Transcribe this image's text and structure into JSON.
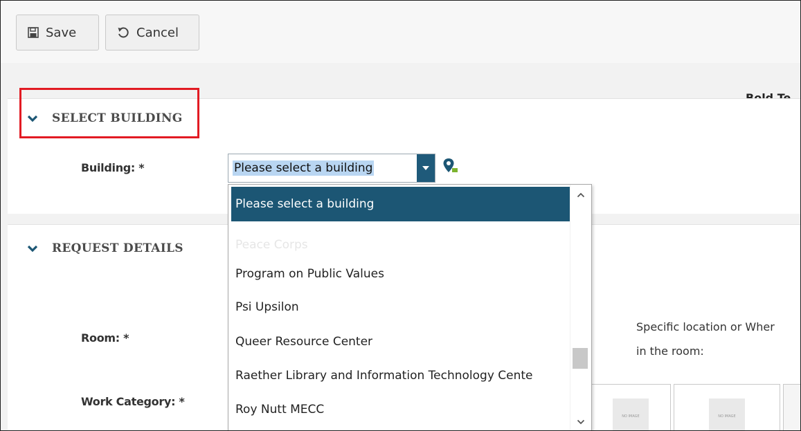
{
  "toolbar": {
    "save_label": "Save",
    "cancel_label": "Cancel"
  },
  "header": {
    "bold_text": "Bold Te"
  },
  "sections": {
    "select_building": {
      "title": "SELECT BUILDING",
      "building_label": "Building: *",
      "building_select": {
        "value": "Please select a building",
        "options": [
          "Please select a building",
          "Peace Corps",
          "Program on Public Values",
          "Psi Upsilon",
          "Queer Resource Center",
          "Raether Library and Information Technology Cente",
          "Roy Nutt MECC"
        ]
      }
    },
    "request_details": {
      "title": "REQUEST DETAILS",
      "room_label": "Room: *",
      "work_category_label": "Work Category: *",
      "specific_location_line1": "Specific location or Wher",
      "specific_location_line2": "in the room:",
      "no_image_label": "NO IMAGE"
    }
  },
  "colors": {
    "accent": "#1c5674",
    "highlight_border": "#e21b23",
    "selection_bg": "#b9d6f2"
  },
  "icons": {
    "save": "floppy-disk-icon",
    "cancel": "undo-icon",
    "section_toggle": "chevron-down-icon",
    "map": "map-pin-icon"
  }
}
